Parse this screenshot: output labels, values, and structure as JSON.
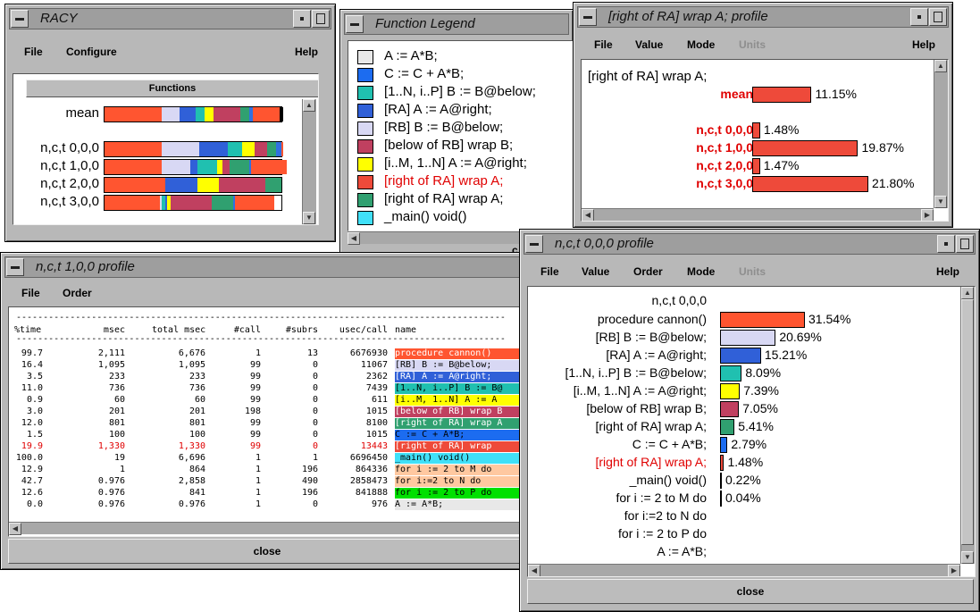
{
  "colors": {
    "mean": "#ee4a3a",
    "bar_red": "#ee4a3a",
    "highlight": "#e00000"
  },
  "racy": {
    "title": "RACY",
    "menu": {
      "file": "File",
      "configure": "Configure",
      "help": "Help"
    },
    "functions_label": "Functions",
    "rows": [
      {
        "label": "mean",
        "segs": [
          [
            "#ff5530",
            0.32
          ],
          [
            "#d8d8f4",
            0.1
          ],
          [
            "#3060d8",
            0.09
          ],
          [
            "#20c0b0",
            0.05
          ],
          [
            "#ffff00",
            0.05
          ],
          [
            "#c04060",
            0.15
          ],
          [
            "#30a070",
            0.05
          ],
          [
            "#3070e0",
            0.02
          ],
          [
            "#ff5530",
            0.15
          ],
          [
            "#000000",
            0.02
          ]
        ]
      },
      {
        "label": "n,c,t 0,0,0",
        "segs": [
          [
            "#ff5530",
            0.32
          ],
          [
            "#d8d8f4",
            0.21
          ],
          [
            "#3060d8",
            0.16
          ],
          [
            "#20c0b0",
            0.08
          ],
          [
            "#ffff00",
            0.07
          ],
          [
            "#c04060",
            0.07
          ],
          [
            "#30a070",
            0.05
          ],
          [
            "#3070e0",
            0.03
          ],
          [
            "#ff5530",
            0.01
          ]
        ]
      },
      {
        "label": "n,c,t 1,0,0",
        "segs": [
          [
            "#ff5530",
            0.32
          ],
          [
            "#d8d8f4",
            0.16
          ],
          [
            "#3060d8",
            0.04
          ],
          [
            "#20c0b0",
            0.11
          ],
          [
            "#ffff00",
            0.03
          ],
          [
            "#c04060",
            0.04
          ],
          [
            "#30a070",
            0.11
          ],
          [
            "#3070e0",
            0.01
          ],
          [
            "#ff5530",
            0.2
          ]
        ]
      },
      {
        "label": "n,c,t 2,0,0",
        "segs": [
          [
            "#ff5530",
            0.34
          ],
          [
            "#3060d8",
            0.18
          ],
          [
            "#ffff00",
            0.12
          ],
          [
            "#c04060",
            0.26
          ],
          [
            "#30a070",
            0.09
          ]
        ]
      },
      {
        "label": "n,c,t 3,0,0",
        "segs": [
          [
            "#ff5530",
            0.31
          ],
          [
            "#d8d8f4",
            0.01
          ],
          [
            "#20c0b0",
            0.02
          ],
          [
            "#3060d8",
            0.01
          ],
          [
            "#ffff00",
            0.02
          ],
          [
            "#c04060",
            0.23
          ],
          [
            "#30a070",
            0.12
          ],
          [
            "#3070e0",
            0.01
          ],
          [
            "#ff5530",
            0.22
          ]
        ]
      }
    ]
  },
  "legend": {
    "title": "Function Legend",
    "items": [
      {
        "label": "A := A*B;",
        "color": "#e8e8e8",
        "red": false
      },
      {
        "label": "C := C + A*B;",
        "color": "#1c6cf0",
        "red": false
      },
      {
        "label": "[1..N, i..P] B := B@below;",
        "color": "#20c0b0",
        "red": false
      },
      {
        "label": "[RA]  A := A@right;",
        "color": "#3060d8",
        "red": false
      },
      {
        "label": "[RB] B := B@below;",
        "color": "#d8d8f4",
        "red": false
      },
      {
        "label": "[below of RB] wrap B;",
        "color": "#c04060",
        "red": false
      },
      {
        "label": "[i..M, 1..N]  A := A@right;",
        "color": "#ffff00",
        "red": false
      },
      {
        "label": "[right of RA]  wrap A;",
        "color": "#ee4a3a",
        "red": true
      },
      {
        "label": "[right of RA] wrap A;",
        "color": "#30a070",
        "red": false
      },
      {
        "label": "_main() void()",
        "color": "#40e0f8",
        "red": false
      }
    ],
    "close": "c"
  },
  "profile_ra": {
    "title": "[right of RA]  wrap A;   profile",
    "menu": {
      "file": "File",
      "value": "Value",
      "mode": "Mode",
      "units": "Units",
      "help": "Help"
    },
    "heading": "[right of RA]  wrap A;",
    "rows": [
      {
        "label": "mean",
        "value": 11.15,
        "text": "11.15%"
      },
      {
        "label": "n,c,t 0,0,0",
        "value": 1.48,
        "text": "1.48%"
      },
      {
        "label": "n,c,t 1,0,0",
        "value": 19.87,
        "text": "19.87%"
      },
      {
        "label": "n,c,t 2,0,0",
        "value": 1.47,
        "text": "1.47%"
      },
      {
        "label": "n,c,t 3,0,0",
        "value": 21.8,
        "text": "21.80%"
      }
    ]
  },
  "profile_000": {
    "title": "n,c,t 0,0,0 profile",
    "menu": {
      "file": "File",
      "value": "Value",
      "order": "Order",
      "mode": "Mode",
      "units": "Units",
      "help": "Help"
    },
    "heading": "n,c,t 0,0,0",
    "rows": [
      {
        "label": "procedure cannon()",
        "value": 31.54,
        "text": "31.54%",
        "color": "#ff5530",
        "red": false
      },
      {
        "label": "[RB] B := B@below;",
        "value": 20.69,
        "text": "20.69%",
        "color": "#d8d8f4",
        "red": false
      },
      {
        "label": "[RA]  A := A@right;",
        "value": 15.21,
        "text": "15.21%",
        "color": "#3060d8",
        "red": false
      },
      {
        "label": "[1..N, i..P] B := B@below;",
        "value": 8.09,
        "text": "8.09%",
        "color": "#20c0b0",
        "red": false
      },
      {
        "label": "[i..M, 1..N]  A := A@right;",
        "value": 7.39,
        "text": "7.39%",
        "color": "#ffff00",
        "red": false
      },
      {
        "label": "[below of RB] wrap B;",
        "value": 7.05,
        "text": "7.05%",
        "color": "#c04060",
        "red": false
      },
      {
        "label": "[right of RA] wrap A;",
        "value": 5.41,
        "text": "5.41%",
        "color": "#30a070",
        "red": false
      },
      {
        "label": "C := C + A*B;",
        "value": 2.79,
        "text": "2.79%",
        "color": "#1c6cf0",
        "red": false
      },
      {
        "label": "[right of RA]  wrap A;",
        "value": 1.48,
        "text": "1.48%",
        "color": "#ee4a3a",
        "red": true
      },
      {
        "label": "_main() void()",
        "value": 0.22,
        "text": "0.22%",
        "color": "#40e0f8",
        "red": false
      },
      {
        "label": "for i := 2 to M do",
        "value": 0.04,
        "text": "0.04%",
        "color": "#ffc8a0",
        "red": false
      },
      {
        "label": "for i:=2 to N do",
        "value": 0,
        "text": "",
        "color": "#ffc8a0",
        "red": false
      },
      {
        "label": "for i := 2 to P do",
        "value": 0,
        "text": "",
        "color": "#00e000",
        "red": false
      },
      {
        "label": "A := A*B;",
        "value": 0,
        "text": "",
        "color": "#e8e8e8",
        "red": false
      }
    ],
    "close": "close"
  },
  "profile_100": {
    "title": "n,c,t 1,0,0 profile",
    "menu": {
      "file": "File",
      "order": "Order"
    },
    "headers": [
      "%time",
      "msec",
      "total msec",
      "#call",
      "#subrs",
      "usec/call",
      "name"
    ],
    "rows": [
      {
        "cells": [
          "99.7",
          "2,111",
          "6,676",
          "1",
          "13",
          "6676930"
        ],
        "name": "procedure cannon()",
        "color": "#ff5530",
        "red": false
      },
      {
        "cells": [
          "16.4",
          "1,095",
          "1,095",
          "99",
          "0",
          "11067"
        ],
        "name": "[RB] B := B@below;",
        "color": "#d8d8f4",
        "red": false
      },
      {
        "cells": [
          "3.5",
          "233",
          "233",
          "99",
          "0",
          "2362"
        ],
        "name": "[RA]  A := A@right;",
        "color": "#3060d8",
        "red": false
      },
      {
        "cells": [
          "11.0",
          "736",
          "736",
          "99",
          "0",
          "7439"
        ],
        "name": "[1..N, i..P] B := B@",
        "color": "#20c0b0",
        "red": false
      },
      {
        "cells": [
          "0.9",
          "60",
          "60",
          "99",
          "0",
          "611"
        ],
        "name": "[i..M, 1..N]  A := A",
        "color": "#ffff00",
        "red": false
      },
      {
        "cells": [
          "3.0",
          "201",
          "201",
          "198",
          "0",
          "1015"
        ],
        "name": "[below of RB] wrap B",
        "color": "#c04060",
        "red": false
      },
      {
        "cells": [
          "12.0",
          "801",
          "801",
          "99",
          "0",
          "8100"
        ],
        "name": "[right of RA] wrap A",
        "color": "#30a070",
        "red": false
      },
      {
        "cells": [
          "1.5",
          "100",
          "100",
          "99",
          "0",
          "1015"
        ],
        "name": "C := C + A*B;",
        "color": "#1c6cf0",
        "red": false
      },
      {
        "cells": [
          "19.9",
          "1,330",
          "1,330",
          "99",
          "0",
          "13443"
        ],
        "name": "[right of RA]  wrap",
        "color": "#ee4a3a",
        "red": true
      },
      {
        "cells": [
          "100.0",
          "19",
          "6,696",
          "1",
          "1",
          "6696450"
        ],
        "name": "_main() void()",
        "color": "#40e0f8",
        "red": false
      },
      {
        "cells": [
          "12.9",
          "1",
          "864",
          "1",
          "196",
          "864336"
        ],
        "name": "for i := 2 to M do",
        "color": "#ffc8a0",
        "red": false
      },
      {
        "cells": [
          "42.7",
          "0.976",
          "2,858",
          "1",
          "490",
          "2858473"
        ],
        "name": "for i:=2 to N do",
        "color": "#ffc8a0",
        "red": false
      },
      {
        "cells": [
          "12.6",
          "0.976",
          "841",
          "1",
          "196",
          "841888"
        ],
        "name": "for i := 2 to P do",
        "color": "#00e000",
        "red": false
      },
      {
        "cells": [
          "0.0",
          "0.976",
          "0.976",
          "1",
          "0",
          "976"
        ],
        "name": " A := A*B;",
        "color": "#e8e8e8",
        "red": false
      }
    ],
    "close": "close"
  }
}
